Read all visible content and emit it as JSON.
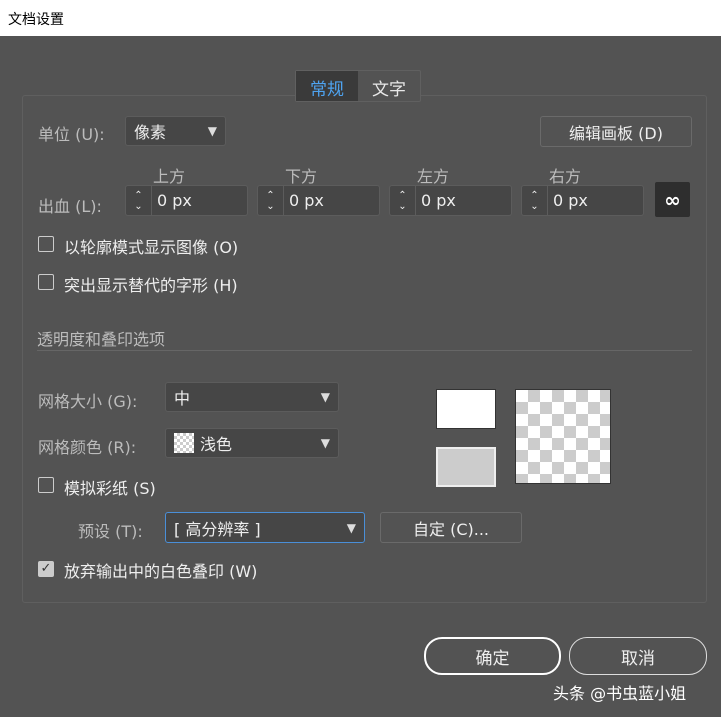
{
  "window": {
    "title": "文档设置"
  },
  "tabs": [
    {
      "label": "常规",
      "active": true
    },
    {
      "label": "文字",
      "active": false
    }
  ],
  "units": {
    "label": "单位 (U):",
    "value": "像素"
  },
  "edit_artboards": "编辑画板 (D)",
  "bleed": {
    "label": "出血 (L):",
    "fields": [
      {
        "label": "上方",
        "value": "0 px"
      },
      {
        "label": "下方",
        "value": "0 px"
      },
      {
        "label": "左方",
        "value": "0 px"
      },
      {
        "label": "右方",
        "value": "0 px"
      }
    ]
  },
  "outline_mode": {
    "label": "以轮廓模式显示图像 (O)",
    "checked": false
  },
  "highlight_glyphs": {
    "label": "突出显示替代的字形 (H)",
    "checked": false
  },
  "section": "透明度和叠印选项",
  "grid_size": {
    "label": "网格大小 (G):",
    "value": "中"
  },
  "grid_color": {
    "label": "网格颜色 (R):",
    "value": "浅色"
  },
  "simulate_paper": {
    "label": "模拟彩纸 (S)",
    "checked": false
  },
  "preset": {
    "label": "预设 (T):",
    "value": "[ 高分辨率 ]"
  },
  "custom_button": "自定 (C)...",
  "discard_white": {
    "label": "放弃输出中的白色叠印 (W)",
    "checked": true
  },
  "ok": "确定",
  "cancel": "取消",
  "watermark": "头条 @书虫蓝小姐"
}
